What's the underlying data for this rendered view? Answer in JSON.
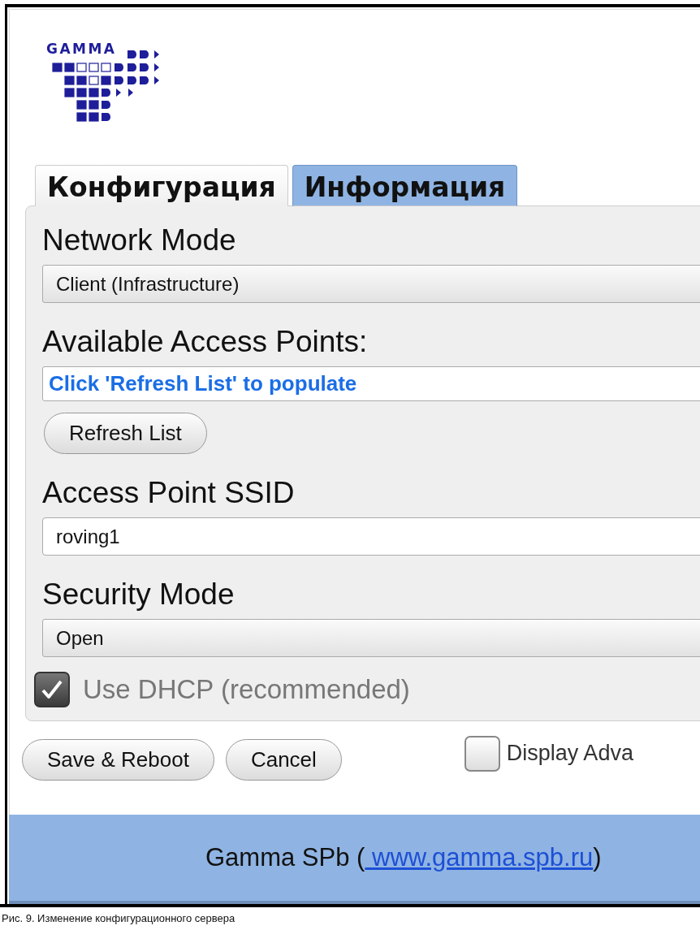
{
  "logo": {
    "text": "GAMMA"
  },
  "tabs": [
    {
      "label": "Конфигурация",
      "selected": true
    },
    {
      "label": "Информация",
      "selected": false
    }
  ],
  "fields": [
    {
      "kind": "select",
      "label": "Network Mode",
      "value": "Client (Infrastructure)"
    },
    {
      "kind": "list",
      "label": "Available Access Points:",
      "value": "Click 'Refresh List' to populate",
      "button": "Refresh List"
    },
    {
      "kind": "input",
      "label": "Access Point SSID",
      "value": "roving1"
    },
    {
      "kind": "select",
      "label": "Security Mode",
      "value": "Open"
    }
  ],
  "dhcp": {
    "label": "Use DHCP (recommended)",
    "checked": true
  },
  "buttons": [
    "Save & Reboot",
    "Cancel"
  ],
  "advanced": {
    "label": "Display Adva",
    "checked": false
  },
  "footer": {
    "text": "Gamma SPb (",
    "link": " www.gamma.spb.ru",
    "suffix": ")"
  },
  "caption": "Рис. 9. Изменение конфигурационного сервера"
}
